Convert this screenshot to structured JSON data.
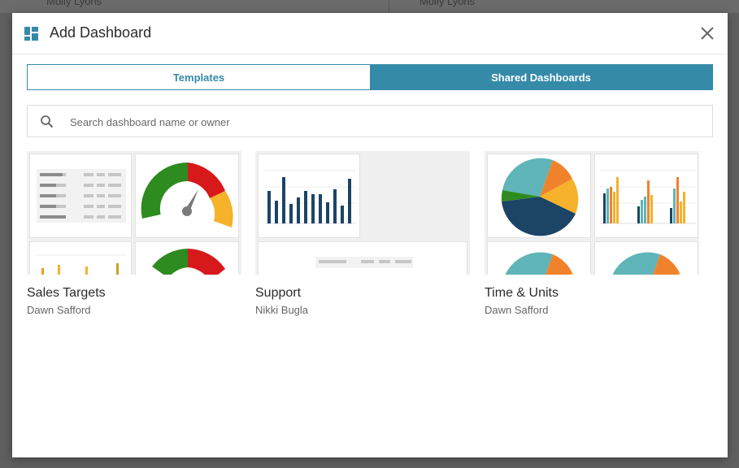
{
  "background": {
    "names": [
      "Molly Lyons",
      "Molly Lyons"
    ]
  },
  "dialog": {
    "title": "Add Dashboard",
    "icon": "dashboard-icon",
    "close_icon": "close-icon"
  },
  "tabs": [
    {
      "label": "Templates",
      "active": false
    },
    {
      "label": "Shared Dashboards",
      "active": true
    }
  ],
  "search": {
    "placeholder": "Search dashboard name or owner",
    "value": "",
    "icon": "search-icon"
  },
  "dashboards": [
    {
      "name": "Sales Targets",
      "owner": "Dawn Safford"
    },
    {
      "name": "Support",
      "owner": "Nikki Bugla"
    },
    {
      "name": "Time & Units",
      "owner": "Dawn Safford"
    }
  ],
  "colors": {
    "accent": "#358aa8",
    "green": "#2e8b1f",
    "red": "#d7191c",
    "orange": "#f39a1e",
    "yellow": "#f5b22a",
    "navy": "#1c4466",
    "teal": "#5fb5b7",
    "orange_pie": "#f0822c"
  }
}
